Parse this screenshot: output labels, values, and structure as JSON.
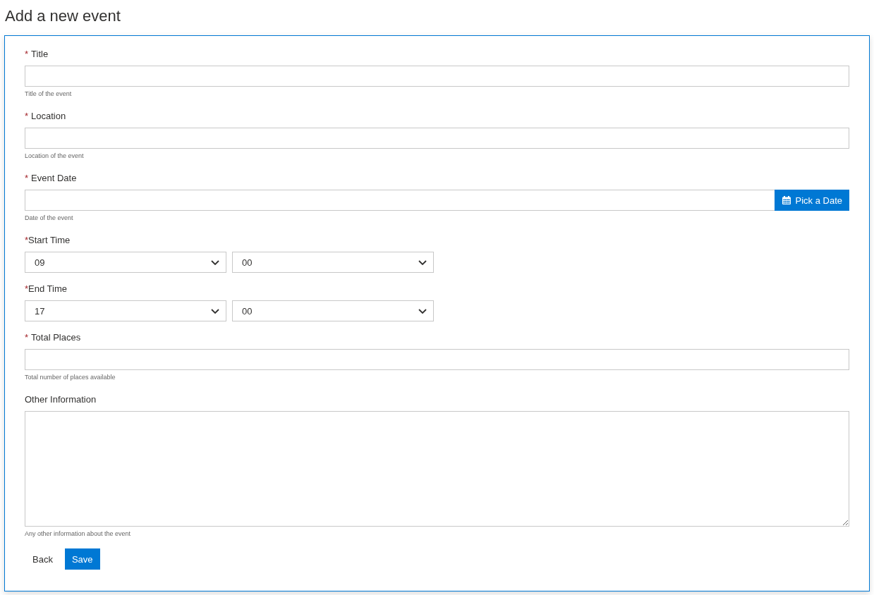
{
  "page": {
    "title": "Add a new event"
  },
  "fields": [
    {
      "kind": "text",
      "mark": "*",
      "label": "Title",
      "hint": "Title of the event"
    },
    {
      "kind": "text",
      "mark": "*",
      "label": "Location",
      "hint": "Location of the event"
    },
    {
      "kind": "date",
      "mark": "*",
      "label": "Event Date",
      "button": "Pick a Date",
      "hint": "Date of the event"
    },
    {
      "kind": "time",
      "mark": "*",
      "label": "Start Time",
      "hour": "09",
      "minute": "00"
    },
    {
      "kind": "time",
      "mark": "*",
      "label": "End Time",
      "hour": "17",
      "minute": "00"
    },
    {
      "kind": "text",
      "mark": "*",
      "label": "Total Places",
      "hint": "Total number of places available"
    },
    {
      "kind": "textarea",
      "label": "Other Information",
      "hint": "Any other information about the event"
    }
  ],
  "buttons": [
    {
      "kind": "plain",
      "label": "Back"
    },
    {
      "kind": "primary",
      "label": "Save"
    }
  ]
}
